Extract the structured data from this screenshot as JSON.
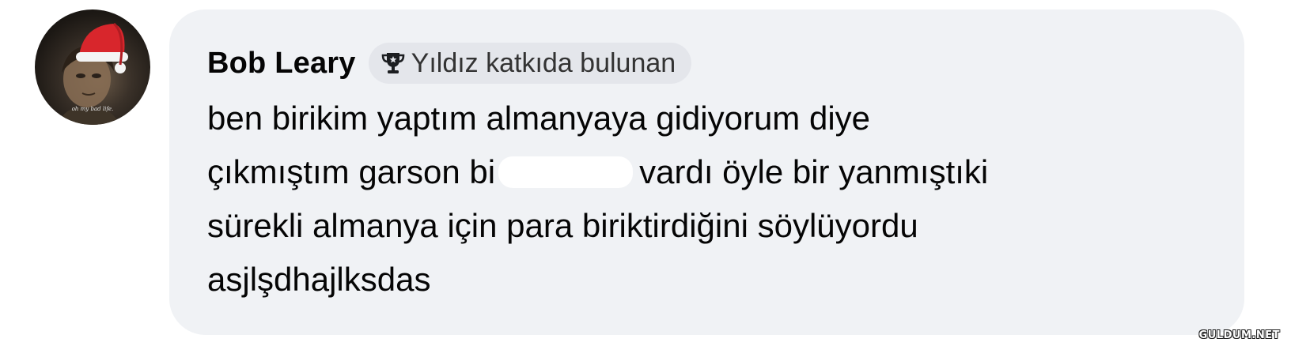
{
  "comment": {
    "author": "Bob Leary",
    "badge": {
      "icon": "trophy-icon",
      "label": "Yıldız katkıda bulunan"
    },
    "lines": [
      "ben birikim yaptım almanyaya gidiyorum diye",
      "çıkmıştım garson bi",
      "vardı öyle bir yanmıştıki",
      "sürekli almanya için para biriktirdiğini söylüyordu",
      "asjlşdhajlksdas"
    ]
  },
  "avatar": {
    "caption": "oh my bad life.",
    "icon": "santa-hat-icon"
  },
  "watermark": "GULDUM.NET",
  "colors": {
    "bubble": "#f0f2f5",
    "badge": "#e4e6eb",
    "text": "#050505",
    "hat_red": "#d8262c"
  }
}
